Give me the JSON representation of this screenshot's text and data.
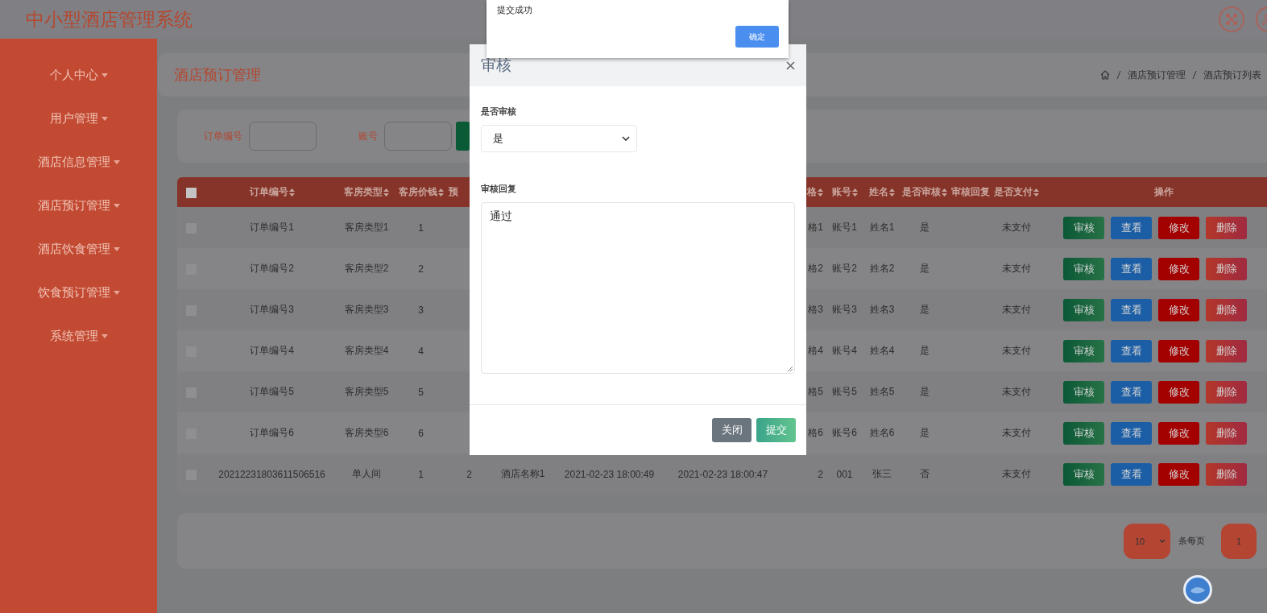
{
  "header": {
    "title": "中小型酒店管理系统"
  },
  "sidebar": {
    "items": [
      {
        "label": "个人中心"
      },
      {
        "label": "用户管理"
      },
      {
        "label": "酒店信息管理"
      },
      {
        "label": "酒店预订管理"
      },
      {
        "label": "酒店饮食管理"
      },
      {
        "label": "饮食预订管理"
      },
      {
        "label": "系统管理"
      }
    ]
  },
  "page_title": "酒店预订管理",
  "breadcrumb": [
    "酒店预订管理",
    "酒店预订列表"
  ],
  "search": {
    "fields": [
      {
        "label": "订单编号"
      },
      {
        "label": "账号"
      }
    ]
  },
  "table": {
    "all_checked": false,
    "columns": [
      {
        "kind": "header",
        "label": "订单编号",
        "sortable": true
      },
      {
        "kind": "header",
        "label": "客房类型",
        "sortable": true
      },
      {
        "kind": "header",
        "label": "客房价钱",
        "sortable": true
      },
      {
        "kind": "header",
        "label": "预"
      },
      {
        "kind": "covered"
      },
      {
        "kind": "covered"
      },
      {
        "kind": "covered"
      },
      {
        "kind": "header",
        "label": "格",
        "sortable": true
      },
      {
        "kind": "header",
        "label": "账号",
        "sortable": true
      },
      {
        "kind": "header",
        "label": "姓名",
        "sortable": true
      },
      {
        "kind": "header",
        "label": "是否审核",
        "sortable": true
      },
      {
        "kind": "header",
        "label": "审核回复",
        "sortable": false
      },
      {
        "kind": "header",
        "label": "是否支付",
        "sortable": true
      },
      {
        "kind": "header",
        "label": "操作",
        "sortable": false
      }
    ],
    "rows": [
      {
        "checked": false,
        "cells": [
          "订单编号1",
          "客房类型1",
          "1",
          null,
          null,
          null,
          null,
          "格1",
          "账号1",
          "姓名1",
          "是",
          null,
          "未支付"
        ],
        "actions": [
          {
            "label": "审核",
            "kind": "review"
          },
          {
            "label": "查看",
            "kind": "view"
          },
          {
            "label": "修改",
            "kind": "edit"
          },
          {
            "label": "删除",
            "kind": "delete"
          }
        ]
      },
      {
        "checked": false,
        "cells": [
          "订单编号2",
          "客房类型2",
          "2",
          null,
          null,
          null,
          null,
          "格2",
          "账号2",
          "姓名2",
          "是",
          null,
          "未支付"
        ],
        "actions": [
          {
            "label": "审核",
            "kind": "review"
          },
          {
            "label": "查看",
            "kind": "view"
          },
          {
            "label": "修改",
            "kind": "edit"
          },
          {
            "label": "删除",
            "kind": "delete"
          }
        ]
      },
      {
        "checked": false,
        "cells": [
          "订单编号3",
          "客房类型3",
          "3",
          null,
          null,
          null,
          null,
          "格3",
          "账号3",
          "姓名3",
          "是",
          null,
          "未支付"
        ],
        "actions": [
          {
            "label": "审核",
            "kind": "review"
          },
          {
            "label": "查看",
            "kind": "view"
          },
          {
            "label": "修改",
            "kind": "edit"
          },
          {
            "label": "删除",
            "kind": "delete"
          }
        ]
      },
      {
        "checked": false,
        "cells": [
          "订单编号4",
          "客房类型4",
          "4",
          null,
          null,
          null,
          null,
          "格4",
          "账号4",
          "姓名4",
          "是",
          null,
          "未支付"
        ],
        "actions": [
          {
            "label": "审核",
            "kind": "review"
          },
          {
            "label": "查看",
            "kind": "view"
          },
          {
            "label": "修改",
            "kind": "edit"
          },
          {
            "label": "删除",
            "kind": "delete"
          }
        ]
      },
      {
        "checked": false,
        "cells": [
          "订单编号5",
          "客房类型5",
          "5",
          null,
          null,
          null,
          null,
          "格5",
          "账号5",
          "姓名5",
          "是",
          null,
          "未支付"
        ],
        "actions": [
          {
            "label": "审核",
            "kind": "review"
          },
          {
            "label": "查看",
            "kind": "view"
          },
          {
            "label": "修改",
            "kind": "edit"
          },
          {
            "label": "删除",
            "kind": "delete"
          }
        ]
      },
      {
        "checked": false,
        "cells": [
          "订单编号6",
          "客房类型6",
          "6",
          null,
          null,
          null,
          null,
          "格6",
          "账号6",
          "姓名6",
          "是",
          null,
          "未支付"
        ],
        "actions": [
          {
            "label": "审核",
            "kind": "review"
          },
          {
            "label": "查看",
            "kind": "view"
          },
          {
            "label": "修改",
            "kind": "edit"
          },
          {
            "label": "删除",
            "kind": "delete"
          }
        ]
      },
      {
        "checked": false,
        "cells": [
          "20212231803611506516",
          "单人间",
          "1",
          "2",
          "酒店名称1",
          "2021-02-23 18:00:49",
          "2021-02-23 18:00:47",
          "2",
          "001",
          "张三",
          "否",
          null,
          "未支付"
        ],
        "actions": [
          {
            "label": "审核",
            "kind": "review"
          },
          {
            "label": "查看",
            "kind": "view"
          },
          {
            "label": "修改",
            "kind": "edit"
          },
          {
            "label": "删除",
            "kind": "delete"
          }
        ]
      }
    ]
  },
  "pagination": {
    "page_size": "10",
    "page_size_label": "条每页",
    "pages": [
      {
        "label": "1",
        "selected": true
      }
    ]
  },
  "modal": {
    "title": "审核",
    "fields": [
      {
        "kind": "select",
        "label": "是否审核",
        "value": "是"
      },
      {
        "kind": "textarea",
        "label": "审核回复",
        "value": "通过"
      }
    ],
    "buttons": [
      {
        "label": "关闭",
        "kind": "secondary"
      },
      {
        "label": "提交",
        "kind": "primary"
      }
    ]
  },
  "alert": {
    "message": "提交成功",
    "button": "确定"
  }
}
